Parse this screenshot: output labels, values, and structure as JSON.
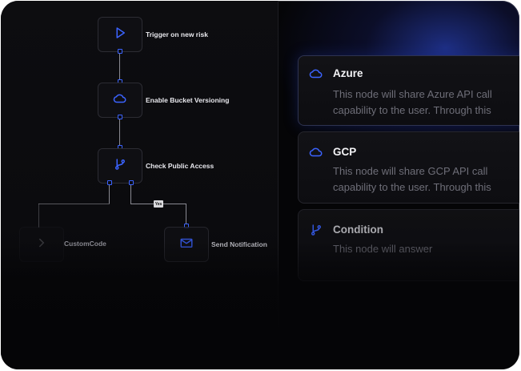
{
  "workflow": {
    "nodes": [
      {
        "label": "Trigger on new risk",
        "icon": "play-icon"
      },
      {
        "label": "Enable Bucket Versioning",
        "icon": "cloud-icon"
      },
      {
        "label": "Check Public Access",
        "icon": "git-branch-icon"
      },
      {
        "label": "CustomCode",
        "icon": "chevron-right-icon"
      },
      {
        "label": "Send Notification",
        "icon": "mail-icon"
      }
    ],
    "branch_tag": "Yes"
  },
  "node_library": {
    "cards": [
      {
        "title": "Azure",
        "icon": "cloud-icon",
        "desc_line1": "This node will share Azure API call",
        "desc_line2": "capability to the user. Through this"
      },
      {
        "title": "GCP",
        "icon": "cloud-icon",
        "desc_line1": "This node will share GCP API call",
        "desc_line2": "capability to the user. Through this"
      },
      {
        "title": "Condition",
        "icon": "git-branch-icon",
        "desc_line1": "This node will answer"
      }
    ]
  },
  "colors": {
    "accent": "#3b63ff",
    "background": "#050507",
    "panel": "#0d0d10"
  }
}
